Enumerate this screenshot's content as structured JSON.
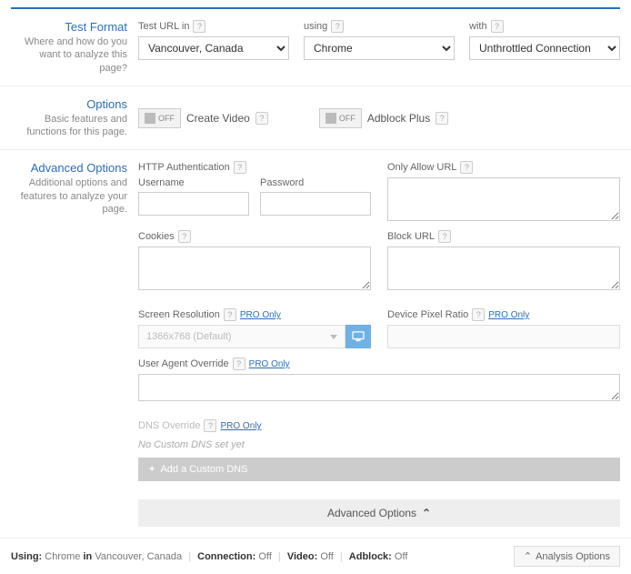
{
  "testFormat": {
    "title": "Test Format",
    "desc": "Where and how do you want to analyze this page?",
    "testUrlLabel": "Test URL in",
    "usingLabel": "using",
    "withLabel": "with",
    "location": "Vancouver, Canada",
    "browser": "Chrome",
    "connection": "Unthrottled Connection"
  },
  "options": {
    "title": "Options",
    "desc": "Basic features and functions for this page.",
    "off": "OFF",
    "createVideo": "Create Video",
    "adblockPlus": "Adblock Plus"
  },
  "advanced": {
    "title": "Advanced Options",
    "desc": "Additional options and features to analyze your page.",
    "httpAuth": "HTTP Authentication",
    "username": "Username",
    "password": "Password",
    "cookies": "Cookies",
    "onlyAllow": "Only Allow URL",
    "blockUrl": "Block URL",
    "screenRes": "Screen Resolution",
    "screenResVal": "1366x768 (Default)",
    "dpr": "Device Pixel Ratio",
    "uao": "User Agent Override",
    "dns": "DNS Override",
    "dnsMsg": "No Custom DNS set yet",
    "dnsBtn": "Add a Custom DNS",
    "pro": "PRO Only",
    "barLabel": "Advanced Options"
  },
  "footer": {
    "using": "Using:",
    "browser": "Chrome",
    "in": "in",
    "location": "Vancouver, Canada",
    "connection": "Connection:",
    "video": "Video:",
    "adblock": "Adblock:",
    "off": "Off",
    "analysisOptions": "Analysis Options"
  }
}
